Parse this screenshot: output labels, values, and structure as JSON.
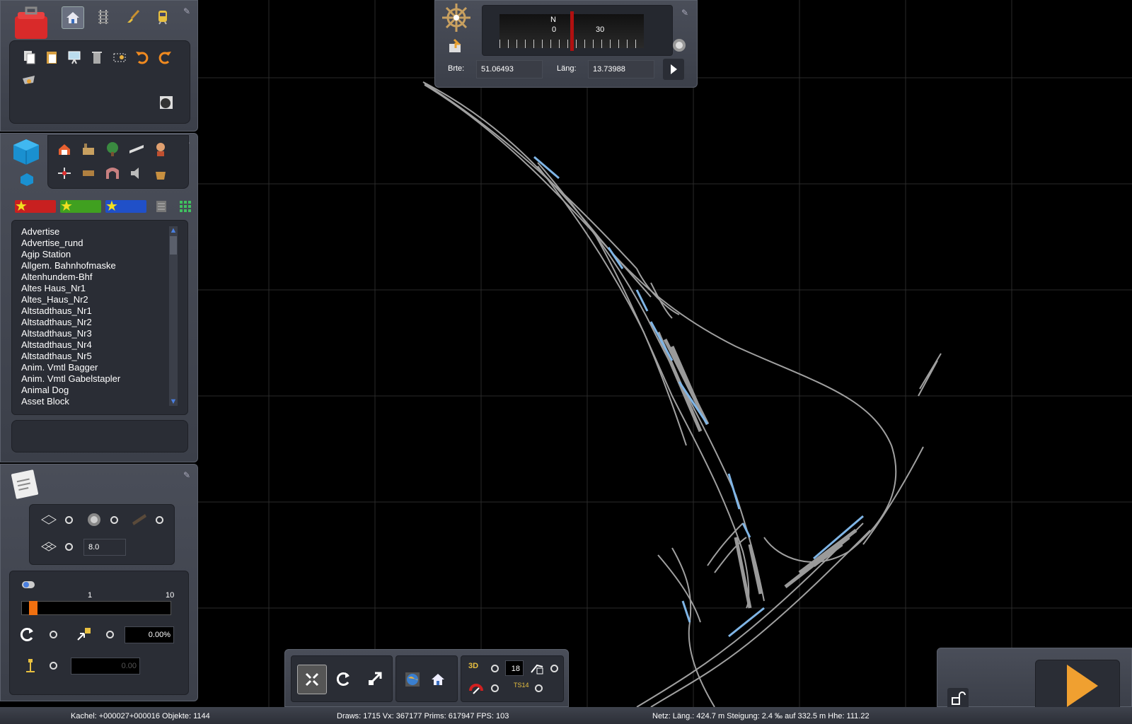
{
  "compass": {
    "north_label": "N",
    "scale_left": "0",
    "scale_right": "30",
    "lat_label": "Brte:",
    "lat_value": "51.06493",
    "lon_label": "Läng:",
    "lon_value": "13.73988"
  },
  "objects_list": {
    "items": [
      "Advertise",
      "Advertise_rund",
      "Agip Station",
      "Allgem. Bahnhofmaske",
      "Altenhundem-Bhf",
      "Altes Haus_Nr1",
      "Altes_Haus_Nr2",
      "Altstadthaus_Nr1",
      "Altstadthaus_Nr2",
      "Altstadthaus_Nr3",
      "Altstadthaus_Nr4",
      "Altstadthaus_Nr5",
      "Anim. Vmtl Bagger",
      "Anim. Vmtl Gabelstapler",
      "Animal Dog",
      "Asset Block"
    ]
  },
  "terrain": {
    "grid_value": "8.0",
    "slider_min": "1",
    "slider_max": "10",
    "slider_level": 0.05,
    "percent_value": "0.00%",
    "height_value": "0.00"
  },
  "bottom_toolbar": {
    "counter_value": "18",
    "ts_label": "TS14",
    "threed_label": "3D"
  },
  "status": {
    "tile": "Kachel: +000027+000016  Objekte: 1144",
    "draws": "Draws: 1715 Vx: 367177 Prims: 617947 FPS: 103",
    "network": "Netz:  Läng.:  424.7 m Steigung:  2.4 ‰ auf 332.5 m Hhe: 111.22"
  },
  "colors": {
    "panel": "#454954",
    "track": "#a0a0a0",
    "highlight": "#7fb5e6",
    "accent": "#f0a030"
  }
}
